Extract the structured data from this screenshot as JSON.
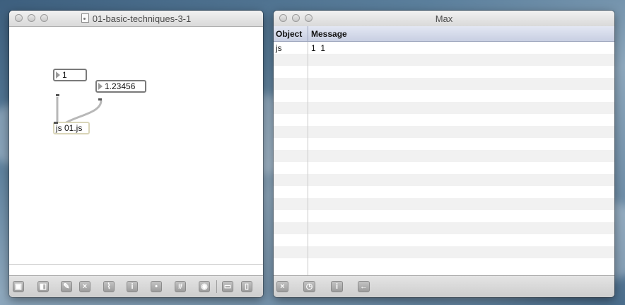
{
  "patcher": {
    "title": "01-basic-techniques-3-1",
    "number_box_1": "1",
    "number_box_2": "1.23456",
    "js_object": "js 01.js",
    "toolbar_icons": [
      "lock-icon",
      "presentation-icon",
      "objects-icon",
      "clear-icon",
      "debug-icon",
      "info-icon",
      "inspector-icon",
      "grid-icon",
      "snapshot-icon",
      "sidebar-bottom-icon",
      "sidebar-right-icon"
    ]
  },
  "console": {
    "title": "Max",
    "columns": {
      "object": "Object",
      "message": "Message"
    },
    "rows": [
      {
        "object": "js",
        "message": "1  1"
      }
    ],
    "toolbar_icons": [
      "clear-icon",
      "timestamp-icon",
      "info-icon",
      "back-icon"
    ]
  },
  "colors": {
    "header_blue": "#c8cfe2",
    "js_border": "#d9d5b8"
  }
}
